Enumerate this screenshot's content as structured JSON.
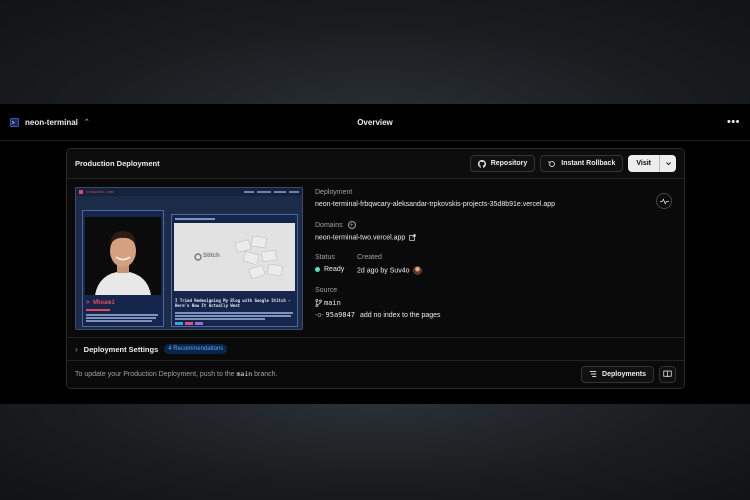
{
  "topbar": {
    "project_name": "neon-terminal",
    "title": "Overview"
  },
  "card": {
    "title": "Production Deployment",
    "repository_label": "Repository",
    "rollback_label": "Instant Rollback",
    "visit_label": "Visit"
  },
  "preview": {
    "site_name": "trpkovski.com",
    "prompt_heading": "> Whoami",
    "post_title": "I Tried Redesigning My Blog with Google Stitch - Here's How It Actually Went",
    "stitch_logo": "Stitch"
  },
  "deployment": {
    "deployment_label": "Deployment",
    "deployment_url": "neon-terminal-frbqwcary-aleksandar-trpkovskis-projects-35d8b91e.vercel.app",
    "domains_label": "Domains",
    "domain": "neon-terminal-two.vercel.app",
    "status_label": "Status",
    "status_value": "Ready",
    "created_label": "Created",
    "created_value": "2d ago by Suv4o",
    "source_label": "Source",
    "branch": "main",
    "commit_hash": "95a9847",
    "commit_message": "add no index to the pages"
  },
  "settings": {
    "label": "Deployment Settings",
    "badge": "4 Recommendations"
  },
  "footer": {
    "note_prefix": "To update your Production Deployment, push to the",
    "note_branch": "main",
    "note_suffix": "branch.",
    "deployments_label": "Deployments"
  },
  "colors": {
    "accent_ready": "#50e3c2",
    "badge_bg": "#0b2549",
    "badge_fg": "#52a8ff"
  }
}
